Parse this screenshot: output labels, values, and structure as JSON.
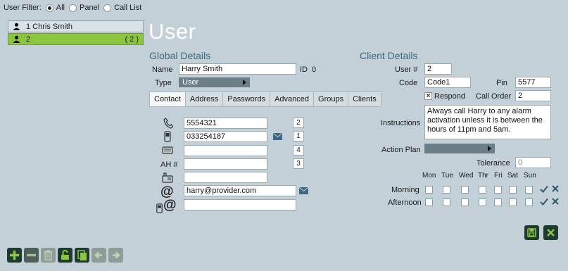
{
  "filter": {
    "label": "User Filter:",
    "options": [
      {
        "label": "All",
        "selected": true
      },
      {
        "label": "Panel",
        "selected": false
      },
      {
        "label": "Call List",
        "selected": false
      }
    ]
  },
  "users": [
    {
      "label": "1 Chris Smith",
      "count": "",
      "selected": false
    },
    {
      "label": "2",
      "count": "( 2 )",
      "selected": true
    }
  ],
  "page_title": "User",
  "global": {
    "heading": "Global Details",
    "name_label": "Name",
    "name_value": "Harry Smith",
    "id_label": "ID",
    "id_value": "0",
    "type_label": "Type",
    "type_value": "User"
  },
  "tabs": [
    "Contact",
    "Address",
    "Passwords",
    "Advanced",
    "Groups",
    "Clients"
  ],
  "contact": {
    "ah_label": "AH #",
    "phone": "5554321",
    "phone_order": "2",
    "mobile": "033254187",
    "mobile_order": "1",
    "fax": "",
    "fax_order": "4",
    "ah": "",
    "ah_order": "3",
    "landline": "",
    "email": "harry@provider.com",
    "sms_email": ""
  },
  "client": {
    "heading": "Client Details",
    "user_num_label": "User #",
    "user_num_value": "2",
    "code_label": "Code",
    "code_value": "Code1",
    "pin_label": "Pin",
    "pin_value": "5577",
    "respond_label": "Respond",
    "call_order_label": "Call Order",
    "call_order_value": "2",
    "instructions_label": "Instructions",
    "instructions_value": "Always call Harry to any alarm activation unless it is between the hours of 11pm and 5am.",
    "action_plan_label": "Action Plan",
    "action_plan_value": "",
    "tolerance_label": "Tolerance",
    "tolerance_value": "0"
  },
  "schedule": {
    "days": [
      "Mon",
      "Tue",
      "Wed",
      "Thr",
      "Fri",
      "Sat",
      "Sun"
    ],
    "rows": [
      "Morning",
      "Afternoon"
    ]
  },
  "colors": {
    "background": "#c3d0d7",
    "accent_green": "#8bc63e",
    "heading_blue": "#3d6a82",
    "dark_button": "#1e3a33"
  }
}
